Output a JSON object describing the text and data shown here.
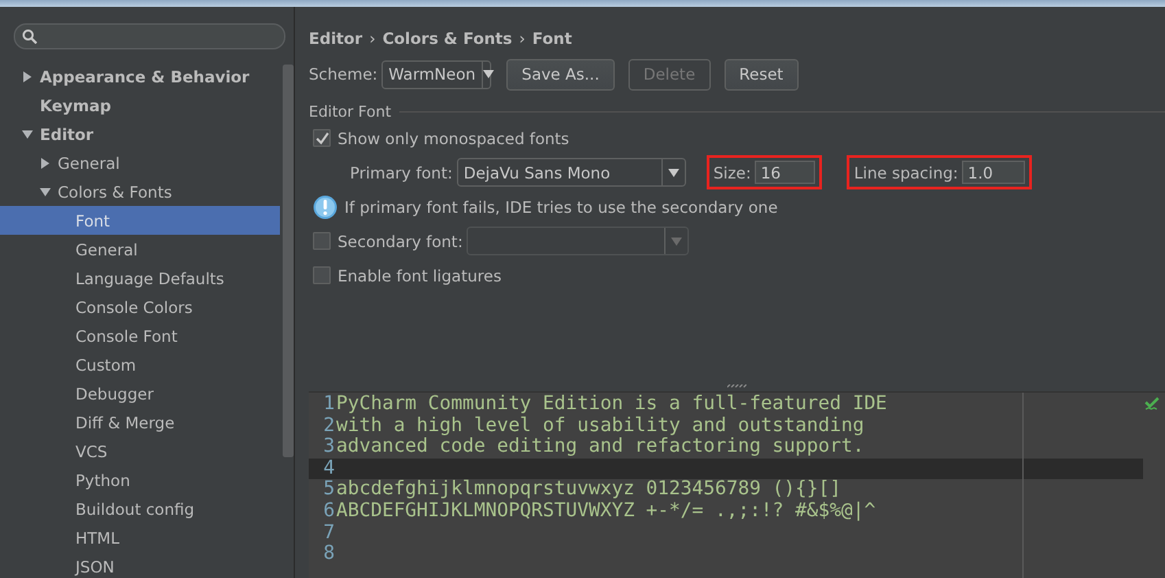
{
  "sidebar": {
    "items": [
      {
        "label": "Appearance & Behavior",
        "kind": "node",
        "expanded": false,
        "selected": false
      },
      {
        "label": "Keymap",
        "kind": "leaf",
        "selected": false
      },
      {
        "label": "Editor",
        "kind": "node",
        "expanded": true,
        "selected": false,
        "children": [
          {
            "label": "General",
            "kind": "node",
            "expanded": false,
            "selected": false
          },
          {
            "label": "Colors & Fonts",
            "kind": "node",
            "expanded": true,
            "selected": false,
            "children": [
              {
                "label": "Font",
                "kind": "leaf",
                "selected": true
              },
              {
                "label": "General",
                "kind": "leaf",
                "selected": false
              },
              {
                "label": "Language Defaults",
                "kind": "leaf",
                "selected": false
              },
              {
                "label": "Console Colors",
                "kind": "leaf",
                "selected": false
              },
              {
                "label": "Console Font",
                "kind": "leaf",
                "selected": false
              },
              {
                "label": "Custom",
                "kind": "leaf",
                "selected": false
              },
              {
                "label": "Debugger",
                "kind": "leaf",
                "selected": false
              },
              {
                "label": "Diff & Merge",
                "kind": "leaf",
                "selected": false
              },
              {
                "label": "VCS",
                "kind": "leaf",
                "selected": false
              },
              {
                "label": "Python",
                "kind": "leaf",
                "selected": false
              },
              {
                "label": "Buildout config",
                "kind": "leaf",
                "selected": false
              },
              {
                "label": "HTML",
                "kind": "leaf",
                "selected": false
              },
              {
                "label": "JSON",
                "kind": "leaf",
                "selected": false
              }
            ]
          }
        ]
      }
    ]
  },
  "breadcrumb": {
    "items": [
      "Editor",
      "Colors & Fonts",
      "Font"
    ],
    "separator": "›"
  },
  "scheme": {
    "label": "Scheme:",
    "value": "WarmNeon"
  },
  "buttons": [
    {
      "label": "Save As...",
      "disabled": false
    },
    {
      "label": "Delete",
      "disabled": true
    },
    {
      "label": "Reset",
      "disabled": false
    }
  ],
  "editor_font": {
    "title": "Editor Font",
    "monospaced": {
      "label": "Show only monospaced fonts",
      "checked": true
    },
    "primary_font": {
      "label": "Primary font:",
      "value": "DejaVu Sans Mono"
    },
    "size": {
      "label": "Size:",
      "value": "16",
      "highlighted": true
    },
    "line_spacing": {
      "label": "Line spacing:",
      "value": "1.0",
      "highlighted": true
    },
    "info": "If primary font fails, IDE tries to use the secondary one",
    "secondary_font": {
      "label": "Secondary font:",
      "checked": false
    },
    "ligatures": {
      "label": "Enable font ligatures",
      "checked": false
    }
  },
  "preview": {
    "lines": [
      {
        "number": "1",
        "text": "PyCharm Community Edition is a full-featured IDE",
        "current": false
      },
      {
        "number": "2",
        "text": "with a high level of usability and outstanding",
        "current": false
      },
      {
        "number": "3",
        "text": "advanced code editing and refactoring support.",
        "current": false
      },
      {
        "number": "4",
        "current": true
      },
      {
        "number": "5",
        "text": "abcdefghijklmnopqrstuvwxyz 0123456789 (){}[]",
        "current": false
      },
      {
        "number": "6",
        "text": "ABCDEFGHIJKLMNOPQRSTUVWXYZ +-*/= .,;:!? #&$%@|^",
        "current": false
      },
      {
        "number": "7",
        "current": false
      },
      {
        "number": "8",
        "current": false
      }
    ]
  }
}
